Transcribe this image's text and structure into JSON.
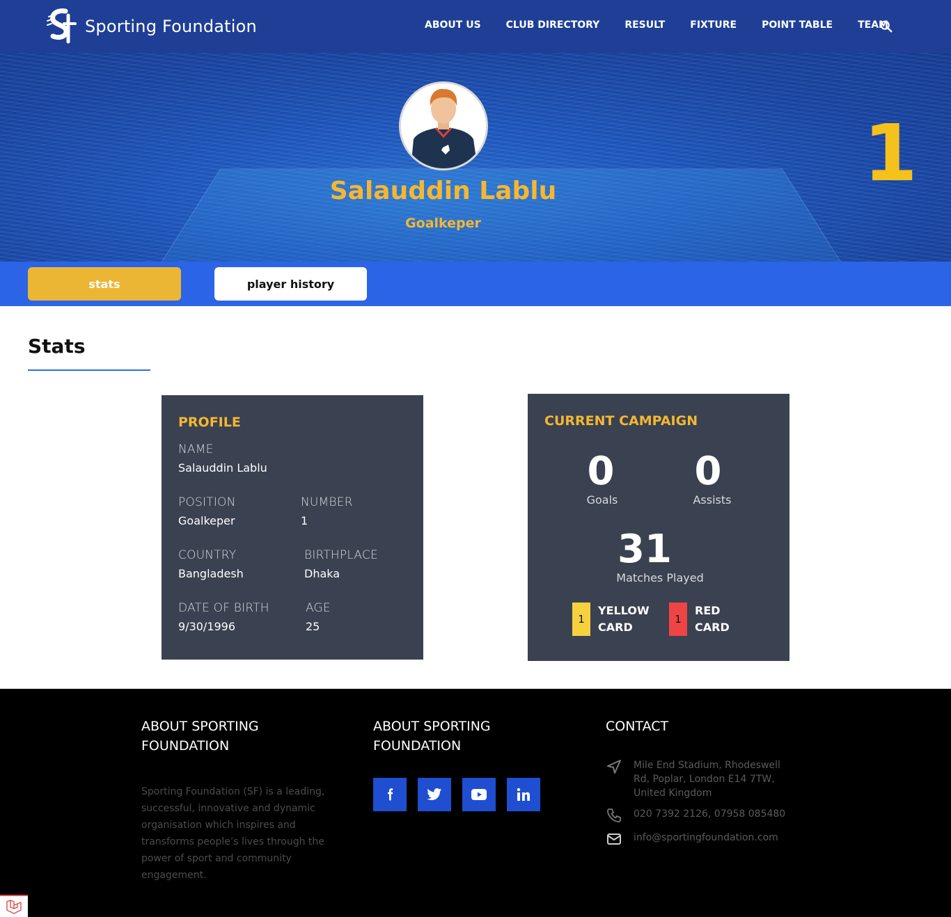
{
  "header": {
    "brand_name": "Sporting Foundation",
    "nav": [
      "ABOUT US",
      "CLUB DIRECTORY",
      "RESULT",
      "FIXTURE",
      "POINT TABLE",
      "TEAM"
    ]
  },
  "hero": {
    "player_name": "Salauddin Lablu",
    "position": "Goalkeper",
    "number": "1"
  },
  "tabs": {
    "stats": "stats",
    "history": "player history"
  },
  "section_title": "Stats",
  "profile": {
    "title": "PROFILE",
    "name_label": "NAME",
    "name_value": "Salauddin Lablu",
    "position_label": "POSITION",
    "position_value": "Goalkeper",
    "number_label": "NUMBER",
    "number_value": "1",
    "country_label": "COUNTRY",
    "country_value": "Bangladesh",
    "birthplace_label": "BIRTHPLACE",
    "birthplace_value": "Dhaka",
    "dob_label": "DATE OF BIRTH",
    "dob_value": "9/30/1996",
    "age_label": "AGE",
    "age_value": "25"
  },
  "campaign": {
    "title": "CURRENT CAMPAIGN",
    "goals": "0",
    "goals_label": "Goals",
    "assists": "0",
    "assists_label": "Assists",
    "matches": "31",
    "matches_label": "Matches Played",
    "yellow_count": "1",
    "yellow_label": "YELLOW CARD",
    "red_count": "1",
    "red_label": "RED CARD"
  },
  "footer": {
    "col1_heading": "ABOUT SPORTING FOUNDATION",
    "col1_text": "Sporting Foundation (SF) is a leading, successful, innovative and dynamic organisation which inspires and transforms people’s lives through the power of sport and community engagement.",
    "col2_heading": "ABOUT SPORTING FOUNDATION",
    "col3_heading": "CONTACT",
    "address": "Mile End Stadium, Rhodeswell Rd, Poplar, London E14 7TW, United Kingdom",
    "phone": "020 7392 2126, 07958 085480",
    "email": "info@sportingfoundation.com",
    "social_icons": [
      "facebook-icon",
      "twitter-icon",
      "youtube-icon",
      "linkedin-icon"
    ]
  },
  "colors": {
    "nav_bg": "#1f3e96",
    "accent_yellow": "#f5b731",
    "tab_bar": "#2b64e6",
    "card_bg": "#3a4150",
    "social_blue": "#1f4fd0"
  }
}
